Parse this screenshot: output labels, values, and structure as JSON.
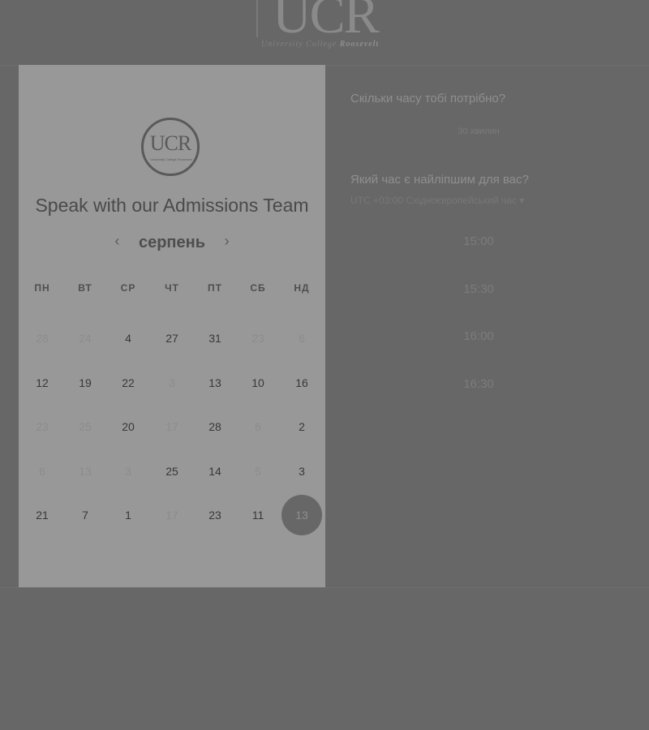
{
  "header": {
    "logo_mark": "UCR",
    "logo_sub": "University College",
    "logo_sub_bold": "Roosevelt"
  },
  "card": {
    "logo_mark": "UCR",
    "logo_sub": "University College Roosevelt",
    "title": "Speak with our Admissions Team",
    "month": "серпень",
    "prev_icon": "‹",
    "next_icon": "›",
    "weekdays": [
      "ПН",
      "ВТ",
      "СР",
      "ЧТ",
      "ПТ",
      "СБ",
      "НД"
    ],
    "weeks": [
      [
        {
          "d": "28",
          "on": false
        },
        {
          "d": "24",
          "on": false
        },
        {
          "d": "4",
          "on": true
        },
        {
          "d": "27",
          "on": true
        },
        {
          "d": "31",
          "on": true
        },
        {
          "d": "23",
          "on": false
        },
        {
          "d": "6",
          "on": false
        }
      ],
      [
        {
          "d": "12",
          "on": true
        },
        {
          "d": "19",
          "on": true
        },
        {
          "d": "22",
          "on": true
        },
        {
          "d": "3",
          "on": false
        },
        {
          "d": "13",
          "on": true
        },
        {
          "d": "10",
          "on": true
        },
        {
          "d": "16",
          "on": true
        }
      ],
      [
        {
          "d": "23",
          "on": false
        },
        {
          "d": "25",
          "on": false
        },
        {
          "d": "20",
          "on": true
        },
        {
          "d": "17",
          "on": false
        },
        {
          "d": "28",
          "on": true
        },
        {
          "d": "6",
          "on": false
        },
        {
          "d": "2",
          "on": true
        }
      ],
      [
        {
          "d": "6",
          "on": false
        },
        {
          "d": "13",
          "on": false
        },
        {
          "d": "3",
          "on": false
        },
        {
          "d": "25",
          "on": true
        },
        {
          "d": "14",
          "on": true
        },
        {
          "d": "5",
          "on": false
        },
        {
          "d": "3",
          "on": true
        }
      ],
      [
        {
          "d": "21",
          "on": true
        },
        {
          "d": "7",
          "on": true
        },
        {
          "d": "1",
          "on": true
        },
        {
          "d": "17",
          "on": false
        },
        {
          "d": "23",
          "on": true
        },
        {
          "d": "11",
          "on": true
        },
        {
          "d": "13",
          "on": true,
          "selected": true
        }
      ]
    ]
  },
  "booking": {
    "duration_question": "Скільки часу тобі потрібно?",
    "duration_value": "30 хвилин",
    "time_question": "Який час є найліпшим для вас?",
    "timezone": "UTC +03:00 Східноєвропейський час",
    "timezone_icon": "▾",
    "slots": [
      "15:00",
      "15:30",
      "16:00",
      "16:30"
    ]
  }
}
